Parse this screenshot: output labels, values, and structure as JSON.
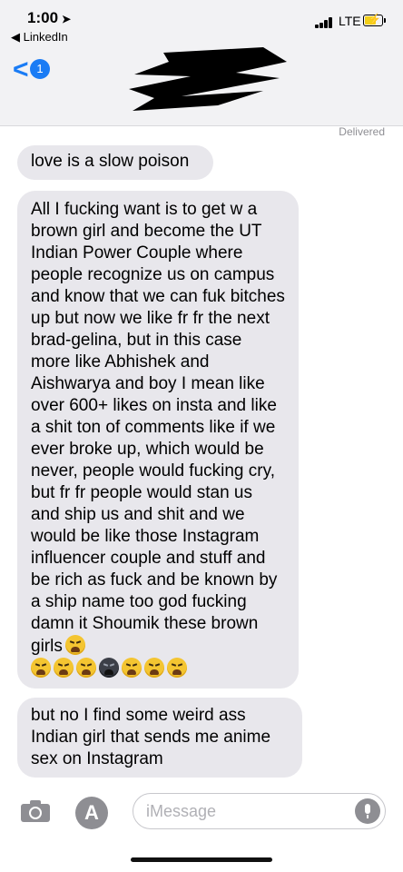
{
  "status_bar": {
    "time": "1:00",
    "location_arrow": "➤",
    "network": "LTE",
    "back_app_label": "◀ LinkedIn"
  },
  "nav": {
    "back_chevron": "<",
    "unread_count": "1",
    "contact_name_redacted": true
  },
  "conversation": {
    "delivered_label": "Delivered",
    "messages": [
      {
        "text": "love is a slow poison"
      },
      {
        "text": "All I fucking want is to get w a brown girl and become the UT Indian Power Couple where people recognize us on campus and know that we can fuk bitches up but now we like fr fr the next brad-gelina, but in this case more like Abhishek and Aishwarya and boy I mean like over 600+ likes on insta and like a shit ton of comments like if we ever broke up, which would be never, people would fucking cry, but fr fr people would stan us and ship us and shit and we would be like those Instagram influencer couple and stuff and be rich as fuck and be known by a ship name too god fucking damn it Shoumik these brown girls"
      },
      {
        "text": "but no I find some weird ass Indian girl that sends me anime sex on Instagram"
      }
    ],
    "emoji_row": [
      "tired-face",
      "tired-face",
      "tired-face",
      "tired-face-dark",
      "tired-face",
      "tired-face",
      "tired-face"
    ]
  },
  "input_bar": {
    "placeholder": "iMessage",
    "appstore_glyph": "A"
  },
  "colors": {
    "accent": "#1a7cf5",
    "bubble": "#e8e7ec",
    "header_bg": "#f2f2f4"
  }
}
